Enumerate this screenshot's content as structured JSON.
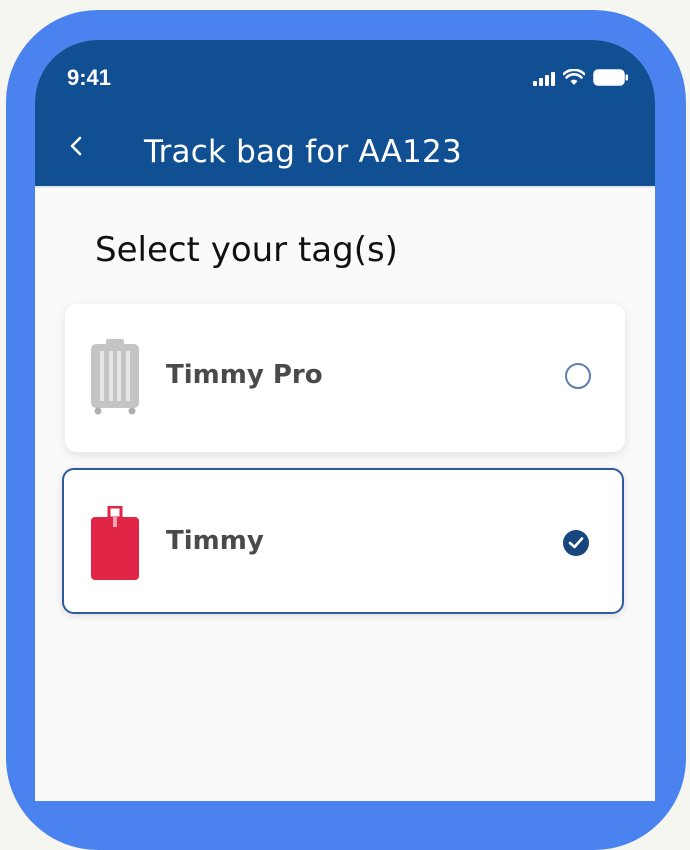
{
  "status_bar": {
    "time": "9:41",
    "icons": [
      "signal-icon",
      "wifi-icon",
      "battery-icon"
    ]
  },
  "header": {
    "back_icon": "chevron-left-icon",
    "title": "Track bag for AA123"
  },
  "main": {
    "title": "Select your tag(s)",
    "tags": [
      {
        "label": "Timmy Pro",
        "icon": "luggage-icon",
        "selected": false
      },
      {
        "label": "Timmy",
        "icon": "luggage-tag-icon",
        "selected": true
      }
    ]
  },
  "colors": {
    "frame": "#4a82f0",
    "header": "#114f93",
    "selected_border": "#2f5aa0",
    "check_fill": "#17467f",
    "tag_red": "#e02547",
    "luggage_gray": "#c4c4c4"
  }
}
